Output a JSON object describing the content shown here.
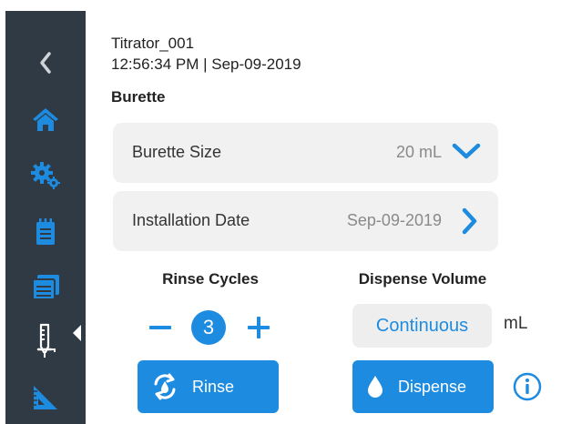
{
  "colors": {
    "sidebar_bg": "#2f3a44",
    "accent": "#1d8be0",
    "row_bg": "#f1f1f1",
    "value_gray": "#8a8a8a"
  },
  "sidebar": {
    "items": [
      {
        "icon": "back-chevron-icon"
      },
      {
        "icon": "home-icon"
      },
      {
        "icon": "settings-gears-icon"
      },
      {
        "icon": "notepad-icon"
      },
      {
        "icon": "calendar-icon"
      },
      {
        "icon": "burette-icon",
        "active": true
      },
      {
        "icon": "ruler-triangle-icon"
      }
    ]
  },
  "header": {
    "device_name": "Titrator_001",
    "datetime": "12:56:34 PM | Sep-09-2019"
  },
  "section": {
    "title": "Burette"
  },
  "burette_size": {
    "label": "Burette Size",
    "value": "20 mL",
    "icon": "chevron-down-icon"
  },
  "installation_date": {
    "label": "Installation Date",
    "value": "Sep-09-2019",
    "icon": "chevron-right-icon"
  },
  "rinse_cycles": {
    "label": "Rinse Cycles",
    "value": "3",
    "decrement_icon": "minus-icon",
    "increment_icon": "plus-icon"
  },
  "dispense_volume": {
    "label": "Dispense Volume",
    "value": "Continuous",
    "unit": "mL"
  },
  "buttons": {
    "rinse": {
      "label": "Rinse",
      "icon": "rinse-cycle-icon"
    },
    "dispense": {
      "label": "Dispense",
      "icon": "water-drop-icon"
    },
    "info": {
      "icon": "info-icon"
    }
  }
}
